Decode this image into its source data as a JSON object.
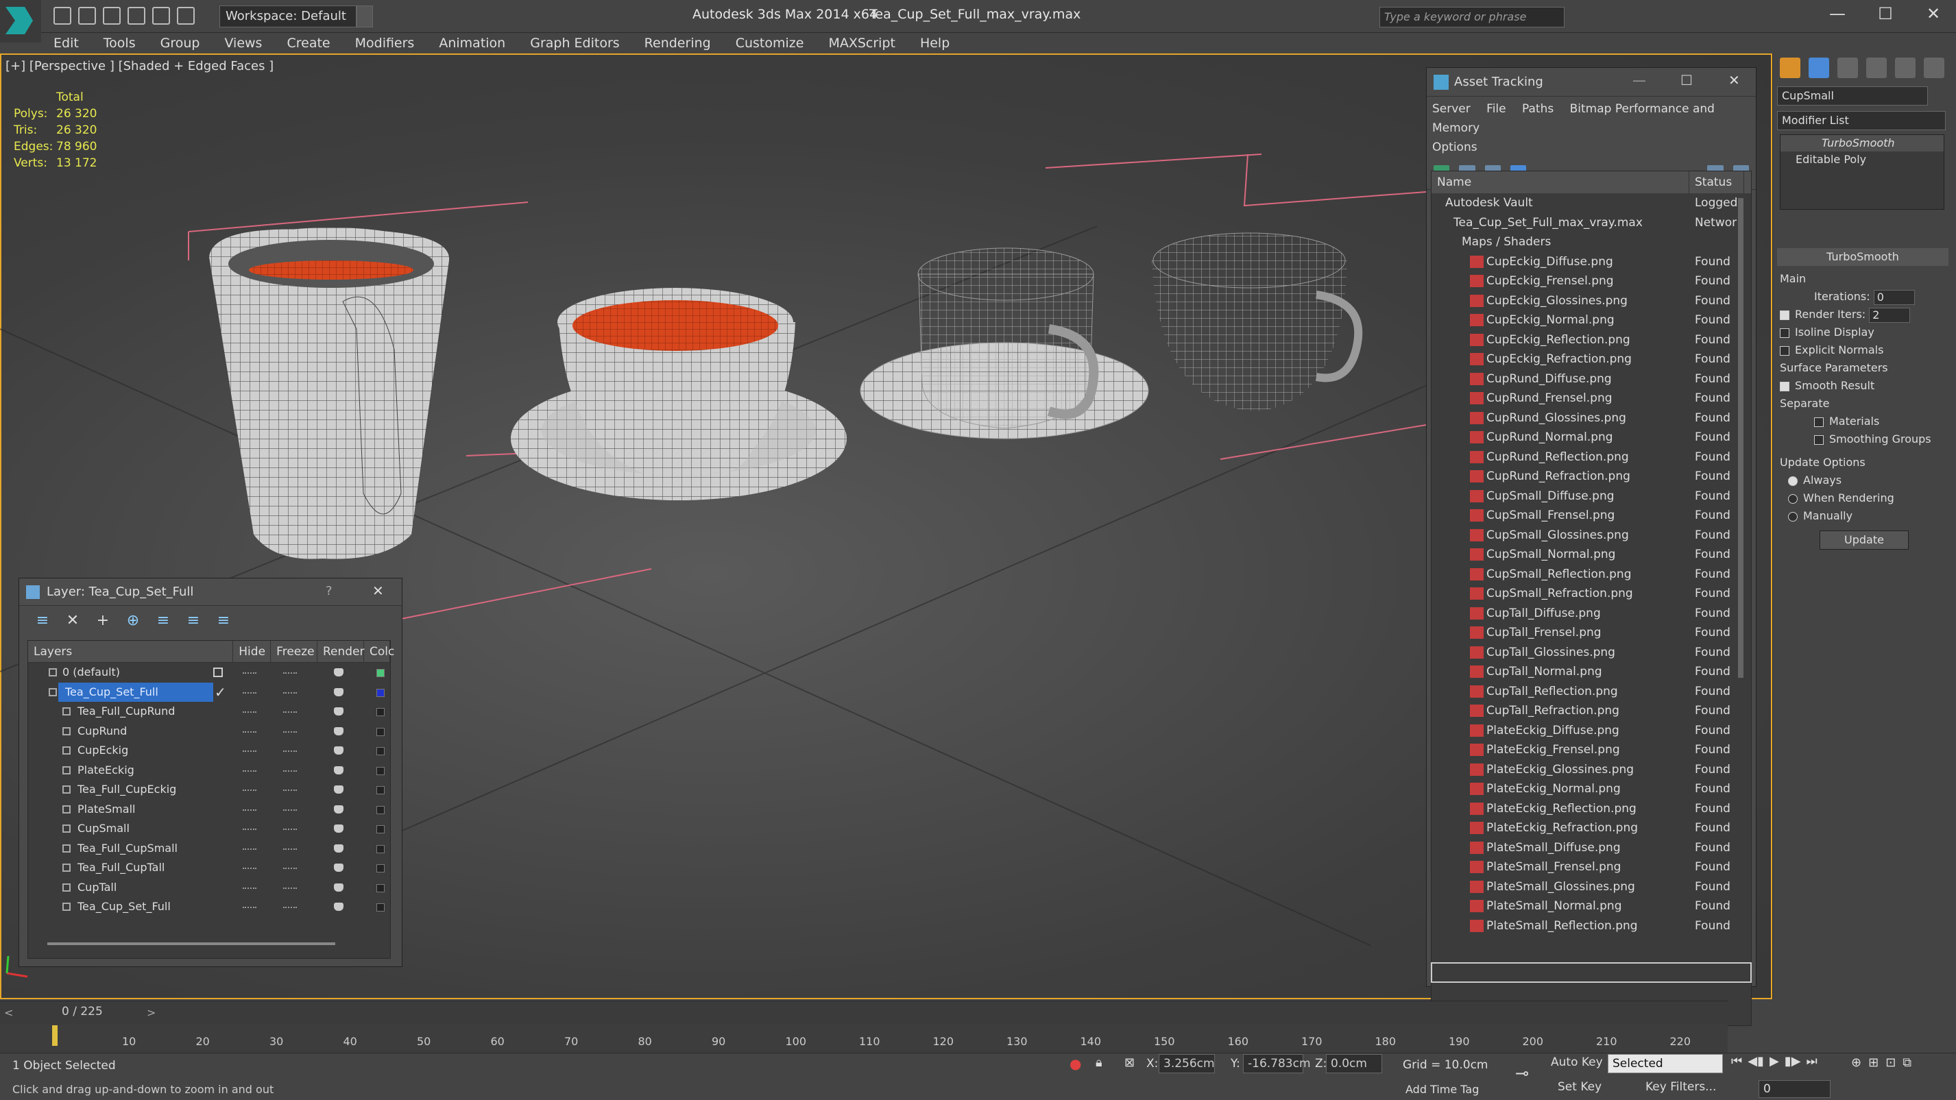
{
  "title_bar": {
    "workspace": "Workspace: Default",
    "app_title": "Autodesk 3ds Max  2014 x64",
    "file_title": "Tea_Cup_Set_Full_max_vray.max",
    "search_placeholder": "Type a keyword or phrase",
    "minimize": "—",
    "maximize": "☐",
    "close": "✕"
  },
  "menu": [
    "Edit",
    "Tools",
    "Group",
    "Views",
    "Create",
    "Modifiers",
    "Animation",
    "Graph Editors",
    "Rendering",
    "Customize",
    "MAXScript",
    "Help"
  ],
  "viewport": {
    "label": "[+] [Perspective ] [Shaded + Edged Faces ]",
    "stats_header": "Total",
    "stats": [
      {
        "k": "Polys:",
        "v": "26 320"
      },
      {
        "k": "Tris:",
        "v": "26 320"
      },
      {
        "k": "Edges:",
        "v": "78 960"
      },
      {
        "k": "Verts:",
        "v": "13 172"
      }
    ]
  },
  "layer_dialog": {
    "title": "Layer: Tea_Cup_Set_Full",
    "help": "?",
    "close": "✕",
    "columns": [
      "Layers",
      "Hide",
      "Freeze",
      "Render",
      "Colc"
    ],
    "rows": [
      "0 (default)",
      "Tea_Cup_Set_Full",
      "Tea_Full_CupRund",
      "CupRund",
      "CupEckig",
      "PlateEckig",
      "Tea_Full_CupEckig",
      "PlateSmall",
      "CupSmall",
      "Tea_Full_CupSmall",
      "Tea_Full_CupTall",
      "CupTall",
      "Tea_Cup_Set_Full"
    ]
  },
  "asset_dialog": {
    "title": "Asset Tracking",
    "menu": [
      "Server",
      "File",
      "Paths",
      "Bitmap Performance and Memory",
      "Options"
    ],
    "columns": [
      "Name",
      "Status"
    ],
    "rows": [
      {
        "name": "Autodesk Vault",
        "status": "Logged",
        "indent": 1
      },
      {
        "name": "Tea_Cup_Set_Full_max_vray.max",
        "status": "Networ",
        "indent": 2
      },
      {
        "name": "Maps / Shaders",
        "status": "",
        "indent": 3
      },
      {
        "name": "CupEckig_Diffuse.png",
        "status": "Found",
        "indent": 4
      },
      {
        "name": "CupEckig_Frensel.png",
        "status": "Found",
        "indent": 4
      },
      {
        "name": "CupEckig_Glossines.png",
        "status": "Found",
        "indent": 4
      },
      {
        "name": "CupEckig_Normal.png",
        "status": "Found",
        "indent": 4
      },
      {
        "name": "CupEckig_Reflection.png",
        "status": "Found",
        "indent": 4
      },
      {
        "name": "CupEckig_Refraction.png",
        "status": "Found",
        "indent": 4
      },
      {
        "name": "CupRund_Diffuse.png",
        "status": "Found",
        "indent": 4
      },
      {
        "name": "CupRund_Frensel.png",
        "status": "Found",
        "indent": 4
      },
      {
        "name": "CupRund_Glossines.png",
        "status": "Found",
        "indent": 4
      },
      {
        "name": "CupRund_Normal.png",
        "status": "Found",
        "indent": 4
      },
      {
        "name": "CupRund_Reflection.png",
        "status": "Found",
        "indent": 4
      },
      {
        "name": "CupRund_Refraction.png",
        "status": "Found",
        "indent": 4
      },
      {
        "name": "CupSmall_Diffuse.png",
        "status": "Found",
        "indent": 4
      },
      {
        "name": "CupSmall_Frensel.png",
        "status": "Found",
        "indent": 4
      },
      {
        "name": "CupSmall_Glossines.png",
        "status": "Found",
        "indent": 4
      },
      {
        "name": "CupSmall_Normal.png",
        "status": "Found",
        "indent": 4
      },
      {
        "name": "CupSmall_Reflection.png",
        "status": "Found",
        "indent": 4
      },
      {
        "name": "CupSmall_Refraction.png",
        "status": "Found",
        "indent": 4
      },
      {
        "name": "CupTall_Diffuse.png",
        "status": "Found",
        "indent": 4
      },
      {
        "name": "CupTall_Frensel.png",
        "status": "Found",
        "indent": 4
      },
      {
        "name": "CupTall_Glossines.png",
        "status": "Found",
        "indent": 4
      },
      {
        "name": "CupTall_Normal.png",
        "status": "Found",
        "indent": 4
      },
      {
        "name": "CupTall_Reflection.png",
        "status": "Found",
        "indent": 4
      },
      {
        "name": "CupTall_Refraction.png",
        "status": "Found",
        "indent": 4
      },
      {
        "name": "PlateEckig_Diffuse.png",
        "status": "Found",
        "indent": 4
      },
      {
        "name": "PlateEckig_Frensel.png",
        "status": "Found",
        "indent": 4
      },
      {
        "name": "PlateEckig_Glossines.png",
        "status": "Found",
        "indent": 4
      },
      {
        "name": "PlateEckig_Normal.png",
        "status": "Found",
        "indent": 4
      },
      {
        "name": "PlateEckig_Reflection.png",
        "status": "Found",
        "indent": 4
      },
      {
        "name": "PlateEckig_Refraction.png",
        "status": "Found",
        "indent": 4
      },
      {
        "name": "PlateSmall_Diffuse.png",
        "status": "Found",
        "indent": 4
      },
      {
        "name": "PlateSmall_Frensel.png",
        "status": "Found",
        "indent": 4
      },
      {
        "name": "PlateSmall_Glossines.png",
        "status": "Found",
        "indent": 4
      },
      {
        "name": "PlateSmall_Normal.png",
        "status": "Found",
        "indent": 4
      },
      {
        "name": "PlateSmall_Reflection.png",
        "status": "Found",
        "indent": 4
      }
    ]
  },
  "command_panel": {
    "object_name": "CupSmall",
    "modifier_list": "Modifier List",
    "stack": [
      "TurboSmooth",
      "Editable Poly"
    ],
    "rollout": "TurboSmooth",
    "main_label": "Main",
    "iterations_label": "Iterations:",
    "iterations": "0",
    "render_iters_label": "Render Iters:",
    "render_iters": "2",
    "isoline": "Isoline Display",
    "explicit_normals": "Explicit Normals",
    "surface_params": "Surface Parameters",
    "smooth_result": "Smooth Result",
    "separate": "Separate",
    "materials": "Materials",
    "smoothing_groups": "Smoothing Groups",
    "update_options": "Update Options",
    "always": "Always",
    "when_rendering": "When Rendering",
    "manually": "Manually",
    "update": "Update"
  },
  "timeline": {
    "frame_label": "0 / 225",
    "ticks": [
      "10",
      "20",
      "30",
      "40",
      "50",
      "60",
      "70",
      "80",
      "90",
      "100",
      "110",
      "120",
      "130",
      "140",
      "150",
      "160",
      "170",
      "180",
      "190",
      "200",
      "210",
      "220"
    ]
  },
  "status": {
    "selected": "1 Object Selected",
    "hint": "Click and drag up-and-down to zoom in and out",
    "x_label": "X:",
    "x_val": "3.256cm",
    "y_label": "Y:",
    "y_val": "-16.783cm",
    "z_label": "Z:",
    "z_val": "0.0cm",
    "grid": "Grid = 10.0cm",
    "auto_key": "Auto Key",
    "set_key": "Set Key",
    "selection_set": "Selected",
    "key_filters": "Key Filters...",
    "add_time_tag": "Add Time Tag",
    "frame": "0"
  },
  "colors": {
    "viewport_border": "#e6a72a",
    "stats_text": "#e8e84f",
    "selection": "#2f6fc7",
    "tea": "#d8461d"
  }
}
